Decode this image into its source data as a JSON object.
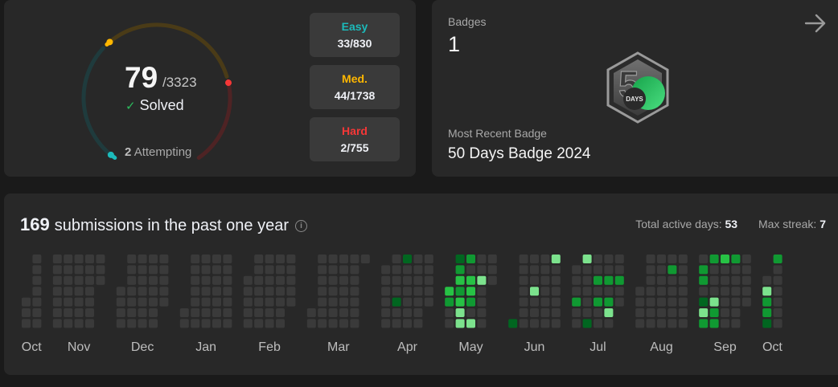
{
  "solved": {
    "count": "79",
    "total": "/3323",
    "solved_label": "Solved",
    "attempting_count": "2",
    "attempting_label": "Attempting",
    "ring": {
      "easy": 33,
      "medium": 44,
      "hard": 2,
      "easy_total": 830,
      "medium_total": 1738,
      "hard_total": 755
    }
  },
  "difficulty": [
    {
      "name": "Easy",
      "count": "33/830",
      "color": "#1cbaba"
    },
    {
      "name": "Med.",
      "count": "44/1738",
      "color": "#ffb700"
    },
    {
      "name": "Hard",
      "count": "2/755",
      "color": "#f63737"
    }
  ],
  "badges": {
    "label": "Badges",
    "count": "1",
    "badge_text": "DAYS",
    "recent_label": "Most Recent Badge",
    "recent_name": "50 Days Badge 2024"
  },
  "heatmap": {
    "submissions_count": "169",
    "submissions_label": "submissions in the past one year",
    "active_days_label": "Total active days:",
    "active_days": "53",
    "max_streak_label": "Max streak:",
    "max_streak": "7",
    "colors": [
      "#3a3a3a",
      "#016620",
      "#109932",
      "#27c245",
      "#7ce28d"
    ],
    "months": [
      {
        "label": "Oct",
        "weeks": [
          [
            -1,
            -1,
            -1,
            -1,
            0,
            0,
            0
          ],
          [
            0,
            0,
            0,
            0,
            0,
            0,
            0
          ]
        ]
      },
      {
        "label": "Nov",
        "weeks": [
          [
            0,
            0,
            0,
            0,
            0,
            0,
            0
          ],
          [
            0,
            0,
            0,
            0,
            0,
            0,
            0
          ],
          [
            0,
            0,
            0,
            0,
            0,
            0,
            0
          ],
          [
            0,
            0,
            0,
            0,
            0,
            0,
            0
          ],
          [
            0,
            0,
            0,
            -1,
            -1,
            -1,
            -1
          ]
        ]
      },
      {
        "label": "Dec",
        "weeks": [
          [
            -1,
            -1,
            -1,
            0,
            0,
            0,
            0
          ],
          [
            0,
            0,
            0,
            0,
            0,
            0,
            0
          ],
          [
            0,
            0,
            0,
            0,
            0,
            0,
            0
          ],
          [
            0,
            0,
            0,
            0,
            0,
            0,
            0
          ],
          [
            0,
            0,
            0,
            0,
            0,
            -1,
            -1
          ]
        ]
      },
      {
        "label": "Jan",
        "weeks": [
          [
            -1,
            -1,
            -1,
            -1,
            -1,
            0,
            0
          ],
          [
            0,
            0,
            0,
            0,
            0,
            0,
            0
          ],
          [
            0,
            0,
            0,
            0,
            0,
            0,
            0
          ],
          [
            0,
            0,
            0,
            0,
            0,
            0,
            0
          ],
          [
            0,
            0,
            0,
            0,
            0,
            0,
            0
          ]
        ]
      },
      {
        "label": "Feb",
        "weeks": [
          [
            -1,
            -1,
            0,
            0,
            0,
            0,
            0
          ],
          [
            0,
            0,
            0,
            0,
            0,
            0,
            0
          ],
          [
            0,
            0,
            0,
            0,
            0,
            0,
            0
          ],
          [
            0,
            0,
            0,
            0,
            0,
            0,
            0
          ],
          [
            0,
            0,
            0,
            0,
            0,
            -1,
            -1
          ]
        ]
      },
      {
        "label": "Mar",
        "weeks": [
          [
            -1,
            -1,
            -1,
            -1,
            -1,
            0,
            0
          ],
          [
            0,
            0,
            0,
            0,
            0,
            0,
            0
          ],
          [
            0,
            0,
            0,
            0,
            0,
            0,
            0
          ],
          [
            0,
            0,
            0,
            0,
            0,
            0,
            0
          ],
          [
            0,
            0,
            0,
            0,
            0,
            0,
            0
          ],
          [
            0,
            -1,
            -1,
            -1,
            -1,
            -1,
            -1
          ]
        ]
      },
      {
        "label": "Apr",
        "weeks": [
          [
            -1,
            0,
            0,
            0,
            0,
            0,
            0
          ],
          [
            0,
            0,
            0,
            0,
            1,
            0,
            0
          ],
          [
            1,
            0,
            0,
            0,
            0,
            0,
            0
          ],
          [
            0,
            0,
            0,
            0,
            0,
            0,
            0
          ],
          [
            0,
            0,
            0,
            0,
            0,
            -1,
            -1
          ]
        ]
      },
      {
        "label": "May",
        "weeks": [
          [
            -1,
            -1,
            -1,
            3,
            2,
            0,
            0
          ],
          [
            1,
            2,
            3,
            2,
            3,
            4,
            4
          ],
          [
            2,
            0,
            3,
            3,
            2,
            0,
            4
          ],
          [
            0,
            0,
            4,
            0,
            0,
            0,
            0
          ],
          [
            0,
            0,
            0,
            -1,
            -1,
            -1,
            -1
          ]
        ]
      },
      {
        "label": "Jun",
        "weeks": [
          [
            -1,
            -1,
            -1,
            -1,
            -1,
            -1,
            1
          ],
          [
            0,
            0,
            0,
            0,
            0,
            0,
            0
          ],
          [
            0,
            0,
            0,
            4,
            0,
            0,
            0
          ],
          [
            0,
            0,
            0,
            0,
            0,
            0,
            0
          ],
          [
            4,
            0,
            0,
            0,
            0,
            0,
            0
          ]
        ]
      },
      {
        "label": "Jul",
        "weeks": [
          [
            -1,
            0,
            0,
            0,
            2,
            0,
            0
          ],
          [
            4,
            0,
            0,
            0,
            0,
            0,
            1
          ],
          [
            0,
            0,
            2,
            0,
            2,
            0,
            0
          ],
          [
            0,
            0,
            2,
            0,
            2,
            4,
            0
          ],
          [
            0,
            0,
            2,
            0,
            0,
            -1,
            -1
          ]
        ]
      },
      {
        "label": "Aug",
        "weeks": [
          [
            -1,
            -1,
            -1,
            0,
            0,
            0,
            0
          ],
          [
            0,
            0,
            0,
            0,
            0,
            0,
            0
          ],
          [
            0,
            0,
            0,
            0,
            0,
            0,
            0
          ],
          [
            0,
            2,
            0,
            0,
            0,
            0,
            0
          ],
          [
            0,
            0,
            0,
            0,
            0,
            0,
            0
          ]
        ]
      },
      {
        "label": "Sep",
        "weeks": [
          [
            0,
            2,
            2,
            0,
            1,
            4,
            2
          ],
          [
            2,
            0,
            0,
            0,
            4,
            2,
            2
          ],
          [
            3,
            0,
            0,
            0,
            0,
            0,
            0
          ],
          [
            2,
            0,
            0,
            0,
            0,
            0,
            0
          ],
          [
            0,
            0,
            0,
            0,
            0,
            -1,
            -1
          ]
        ]
      },
      {
        "label": "Oct",
        "weeks": [
          [
            -1,
            -1,
            0,
            4,
            2,
            2,
            1
          ],
          [
            2,
            0,
            0,
            0,
            0,
            0,
            0
          ]
        ]
      }
    ]
  }
}
